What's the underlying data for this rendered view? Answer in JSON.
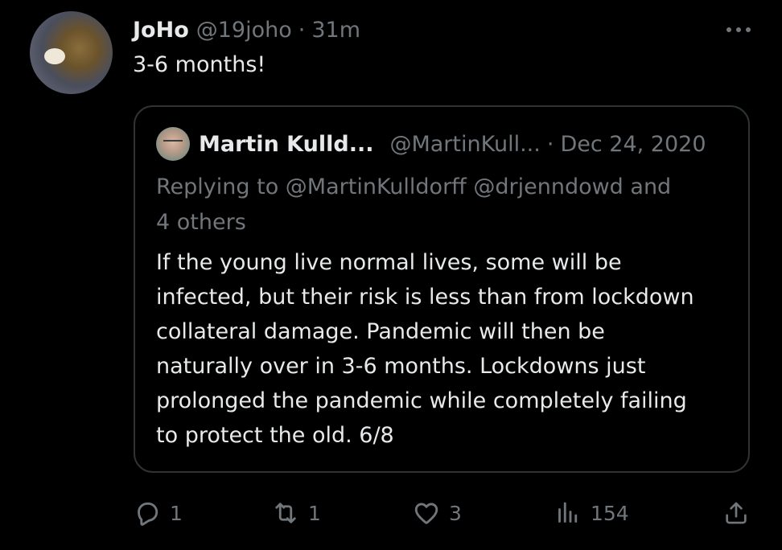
{
  "tweet": {
    "author_name": "JoHo",
    "author_handle": "@19joho",
    "separator": "·",
    "time": "31m",
    "text": "3-6 months!"
  },
  "quoted_tweet": {
    "author_name": "Martin Kulld...",
    "author_handle": "@MartinKull...",
    "separator": "·",
    "date": "Dec 24, 2020",
    "replying_lines": [
      "Replying to @MartinKulldorff @drjenndowd and",
      "4 others"
    ],
    "body_lines": [
      "If the young live normal lives, some will be",
      "infected, but their risk is less than from lockdown",
      "collateral damage. Pandemic will then be",
      "naturally over in 3-6 months. Lockdowns just",
      "prolonged the pandemic while completely failing",
      "to protect the old. 6/8"
    ]
  },
  "actions": {
    "reply_count": "1",
    "retweet_count": "1",
    "like_count": "3",
    "views_count": "154"
  },
  "icons": {
    "more": "more-horizontal-icon",
    "reply": "reply-icon",
    "retweet": "retweet-icon",
    "like": "heart-icon",
    "views": "analytics-icon",
    "share": "share-icon"
  },
  "colors": {
    "background": "#000000",
    "text_primary": "#e7e9ea",
    "text_muted": "#71767b",
    "border": "#2f3336"
  }
}
